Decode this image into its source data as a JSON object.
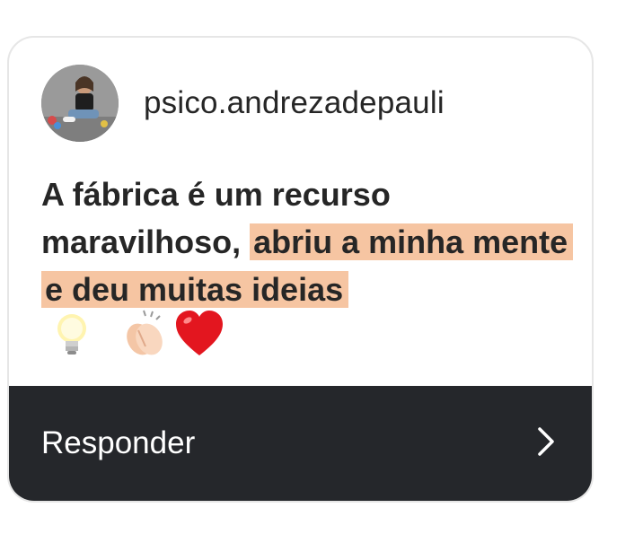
{
  "comment": {
    "username": "psico.andrezadepauli",
    "text_plain": "A fábrica é um recurso maravilhoso, ",
    "text_highlight": "abriu a minha mente e deu muitas ideias",
    "emojis": [
      "lightbulb-icon",
      "clapping-hands-icon",
      "red-heart-icon"
    ]
  },
  "reply": {
    "label": "Responder",
    "icon": "chevron-right-icon"
  },
  "colors": {
    "highlight": "#f6c5a2",
    "reply_bar": "#25272b",
    "text": "#262626"
  }
}
